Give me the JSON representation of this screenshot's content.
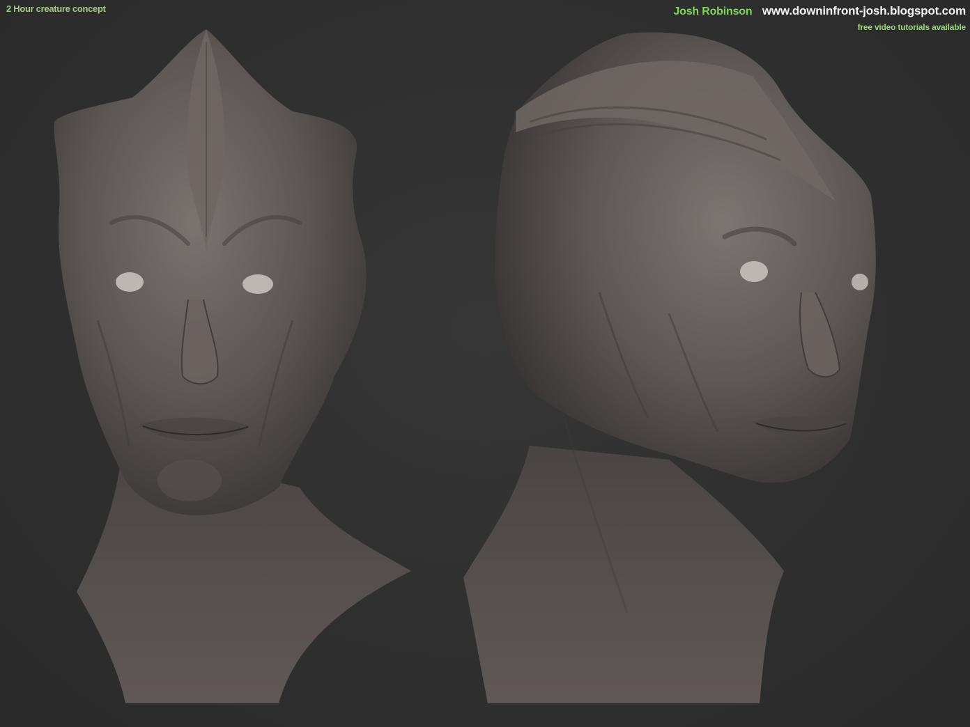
{
  "caption": "2 Hour creature concept",
  "author": {
    "name": "Josh Robinson",
    "url": "www.downinfront-josh.blogspot.com",
    "note": "free video tutorials available"
  },
  "colors": {
    "background": "#2e2e2e",
    "caption_text": "#a8c88a",
    "author_name": "#7fd65a",
    "url_text": "#f2f2f2",
    "note_text": "#98d47a",
    "clay": "#5e5855"
  },
  "views": [
    {
      "label": "",
      "icon": "front-view-head"
    },
    {
      "label": "",
      "icon": "three-quarter-view-head"
    }
  ]
}
